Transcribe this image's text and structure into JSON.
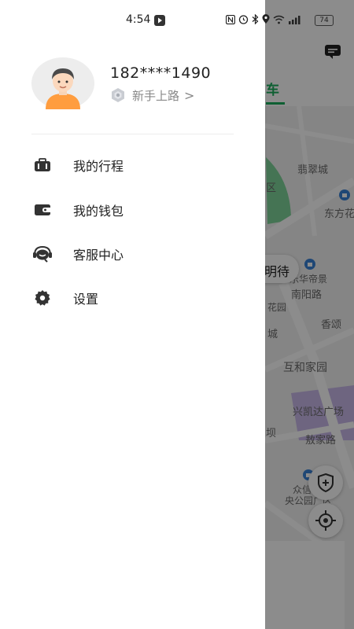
{
  "status_bar": {
    "time": "4:54",
    "battery": "74"
  },
  "user": {
    "phone": "182****1490",
    "level": "新手上路",
    "level_chevron": ">"
  },
  "menu": [
    {
      "label": "我的行程",
      "icon": "suitcase-icon"
    },
    {
      "label": "我的钱包",
      "icon": "wallet-icon"
    },
    {
      "label": "客服中心",
      "icon": "headset-icon"
    },
    {
      "label": "设置",
      "icon": "gear-icon"
    }
  ],
  "map": {
    "tab_label": "车",
    "wait_label": "明待",
    "places": [
      "翡翠城",
      "区",
      "东方花",
      "乐华帝景",
      "南阳路",
      "花园",
      "香颂",
      "城",
      "互和家园",
      "兴凯达广场",
      "坝",
      "敖家路",
      "众信",
      "央公园广区"
    ]
  },
  "colors": {
    "accent": "#1aad5c",
    "overlay": "rgba(0,0,0,0.45)"
  }
}
